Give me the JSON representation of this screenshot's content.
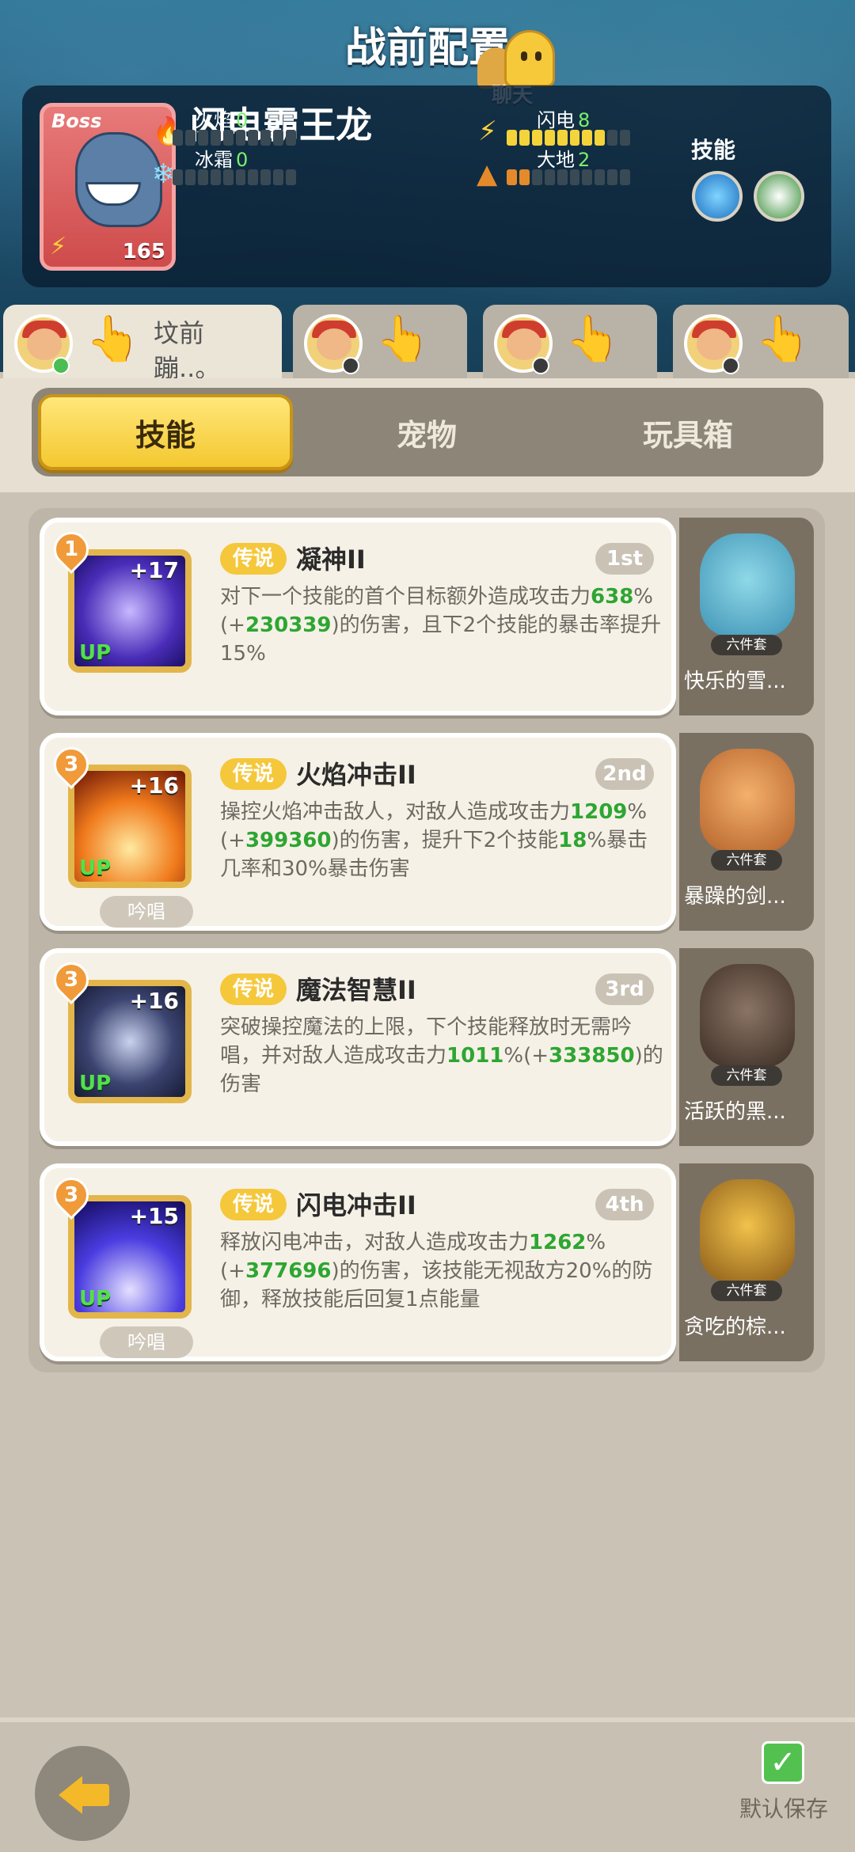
{
  "header": {
    "title": "战前配置",
    "chat_label": "聊天"
  },
  "boss": {
    "tag": "Boss",
    "name": "闪电霸王龙",
    "level": "165",
    "stats": {
      "fire": {
        "label": "火焰",
        "value": "0",
        "fill": 0
      },
      "lightning": {
        "label": "闪电",
        "value": "8",
        "fill": 8
      },
      "ice": {
        "label": "冰霜",
        "value": "0",
        "fill": 0
      },
      "earth": {
        "label": "大地",
        "value": "2",
        "fill": 2
      }
    },
    "skills_label": "技能"
  },
  "loadouts": [
    {
      "name": "坟前蹦..。",
      "active": true
    },
    {
      "name": "",
      "active": false
    },
    {
      "name": "",
      "active": false
    },
    {
      "name": "",
      "active": false
    }
  ],
  "categories": [
    "技能",
    "宠物",
    "玩具箱"
  ],
  "skills": [
    {
      "level": "1",
      "plus": "+17",
      "up": "UP",
      "rarity": "传说",
      "name": "凝神II",
      "rank": "1st",
      "desc": [
        "对下一个技能的首个目标额外造成攻击力",
        "638",
        "%(+",
        "230339",
        ")的伤害，且下2个技能的暴击率提升15%"
      ],
      "chant": "",
      "pet": {
        "set": "六件套",
        "name": "快乐的雪..."
      }
    },
    {
      "level": "3",
      "plus": "+16",
      "up": "UP",
      "rarity": "传说",
      "name": "火焰冲击II",
      "rank": "2nd",
      "desc": [
        "操控火焰冲击敌人，对敌人造成攻击力",
        "1209",
        "%(+",
        "399360",
        ")的伤害，提升下2个技能",
        "18",
        "%暴击几率和30%暴击伤害"
      ],
      "chant": "吟唱",
      "pet": {
        "set": "六件套",
        "name": "暴躁的剑..."
      }
    },
    {
      "level": "3",
      "plus": "+16",
      "up": "UP",
      "rarity": "传说",
      "name": "魔法智慧II",
      "rank": "3rd",
      "desc": [
        "突破操控魔法的上限，下个技能释放时无需吟唱，并对敌人造成攻击力",
        "1011",
        "%(+",
        "333850",
        ")的伤害"
      ],
      "chant": "",
      "pet": {
        "set": "六件套",
        "name": "活跃的黑..."
      }
    },
    {
      "level": "3",
      "plus": "+15",
      "up": "UP",
      "rarity": "传说",
      "name": "闪电冲击II",
      "rank": "4th",
      "desc": [
        "释放闪电冲击，对敌人造成攻击力",
        "1262",
        "%(+",
        "377696",
        ")的伤害，该技能无视敌方20%的防御，释放技能后回复1点能量"
      ],
      "chant": "吟唱",
      "pet": {
        "set": "六件套",
        "name": "贪吃的棕..."
      }
    }
  ],
  "footer": {
    "save_label": "默认保存",
    "save_checked": true
  },
  "colors": {
    "accent_gold": "#f4c830",
    "legend_orange": "#f5c73a",
    "green_value": "#2da632"
  }
}
